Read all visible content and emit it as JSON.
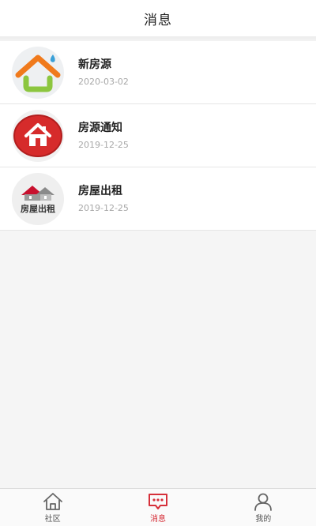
{
  "header": {
    "title": "消息"
  },
  "messages": [
    {
      "title": "新房源",
      "date": "2020-03-02",
      "icon": "new-house-icon"
    },
    {
      "title": "房源通知",
      "date": "2019-12-25",
      "icon": "house-notice-icon"
    },
    {
      "title": "房屋出租",
      "date": "2019-12-25",
      "icon": "house-rental-icon",
      "icon_text": "房屋出租"
    }
  ],
  "tabbar": {
    "items": [
      {
        "label": "社区",
        "icon": "home-icon",
        "active": false
      },
      {
        "label": "消息",
        "icon": "message-icon",
        "active": true
      },
      {
        "label": "我的",
        "icon": "user-icon",
        "active": false
      }
    ]
  },
  "colors": {
    "accent": "#d6303a",
    "orange": "#f07a1c",
    "green": "#8cc63f",
    "blue": "#3aa0d8"
  }
}
